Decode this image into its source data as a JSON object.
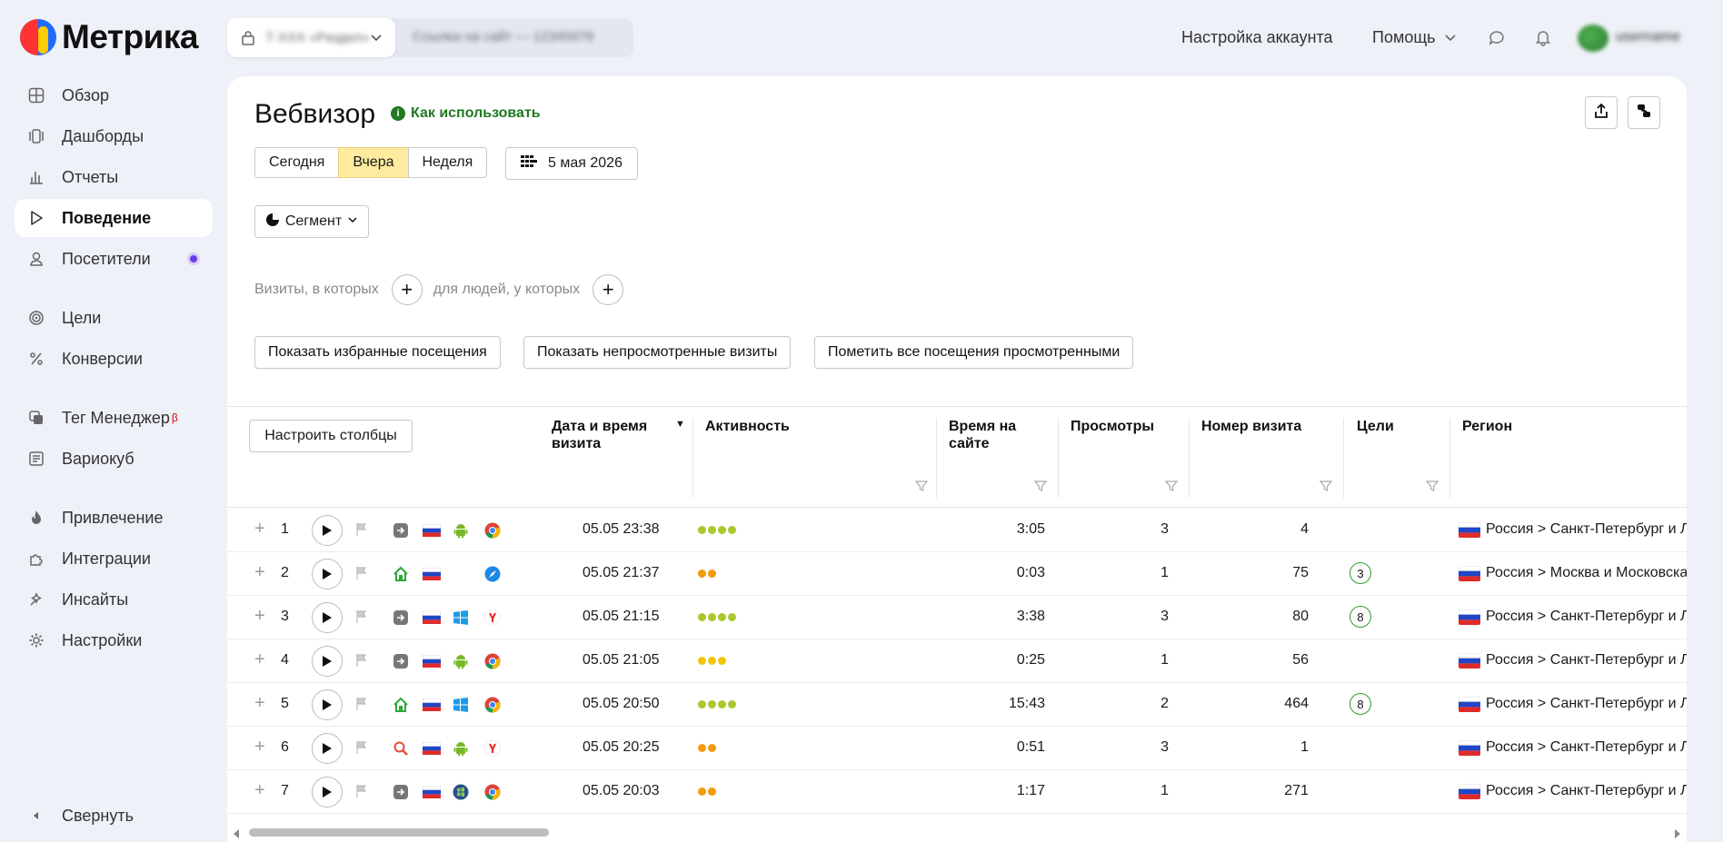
{
  "app": {
    "name": "Метрика"
  },
  "header": {
    "counter_name": "Т-ХХХ «Раздел»",
    "counter_id": "Ссылка на сайт — 12345678",
    "account_settings": "Настройка аккаунта",
    "help": "Помощь",
    "user_name": "username"
  },
  "sidebar": {
    "items": [
      {
        "label": "Обзор",
        "icon": "overview-icon"
      },
      {
        "label": "Дашборды",
        "icon": "dashboards-icon"
      },
      {
        "label": "Отчеты",
        "icon": "reports-icon"
      },
      {
        "label": "Поведение",
        "icon": "behavior-icon",
        "active": true
      },
      {
        "label": "Посетители",
        "icon": "visitors-icon"
      },
      {
        "label": "Цели",
        "icon": "goals-icon"
      },
      {
        "label": "Конверсии",
        "icon": "conversions-icon"
      },
      {
        "label": "Тег Менеджер",
        "icon": "tag-manager-icon",
        "badge": "β"
      },
      {
        "label": "Вариокуб",
        "icon": "variocube-icon"
      },
      {
        "label": "Привлечение",
        "icon": "acquisition-icon"
      },
      {
        "label": "Интеграции",
        "icon": "integrations-icon"
      },
      {
        "label": "Инсайты",
        "icon": "insights-icon"
      },
      {
        "label": "Настройки",
        "icon": "settings-icon"
      }
    ],
    "collapse": "Свернуть"
  },
  "page": {
    "title": "Вебвизор",
    "how_to": "Как использовать",
    "periods": [
      "Сегодня",
      "Вчера",
      "Неделя"
    ],
    "active_period": "Вчера",
    "date": "5 мая 2026",
    "segment": "Сегмент",
    "filter_visits": "Визиты, в которых",
    "filter_people": "для людей, у которых",
    "btn_favorites": "Показать избранные посещения",
    "btn_unwatched": "Показать непросмотренные визиты",
    "btn_mark_all": "Пометить все посещения просмотренными"
  },
  "table": {
    "configure": "Настроить столбцы",
    "columns": {
      "datetime": "Дата и время визита",
      "activity": "Активность",
      "time_on_site": "Время на сайте",
      "views": "Просмотры",
      "visit_number": "Номер визита",
      "goals": "Цели",
      "region": "Регион"
    },
    "sort_indicator": "▼",
    "colors": {
      "green": "#a8c82e",
      "yellow": "#f2c80f",
      "orange": "#f49a0c"
    },
    "rows": [
      {
        "n": "1",
        "source": "direct",
        "os": "android",
        "browser": "chrome",
        "datetime": "05.05 23:38",
        "activity": 4,
        "activity_color": "#a8c82e",
        "time": "3:05",
        "views": "3",
        "visit": "4",
        "goals": "",
        "region": "Россия > Санкт-Петербург и Л"
      },
      {
        "n": "2",
        "source": "internal",
        "os": "",
        "browser": "safari",
        "datetime": "05.05 21:37",
        "activity": 2,
        "activity_color": "#f49a0c",
        "time": "0:03",
        "views": "1",
        "visit": "75",
        "goals": "3",
        "region": "Россия > Москва и Московска"
      },
      {
        "n": "3",
        "source": "direct",
        "os": "windows",
        "browser": "yandex",
        "datetime": "05.05 21:15",
        "activity": 4,
        "activity_color": "#a8c82e",
        "time": "3:38",
        "views": "3",
        "visit": "80",
        "goals": "8",
        "region": "Россия > Санкт-Петербург и Л"
      },
      {
        "n": "4",
        "source": "direct",
        "os": "android",
        "browser": "chrome",
        "datetime": "05.05 21:05",
        "activity": 3,
        "activity_color": "#f2c80f",
        "time": "0:25",
        "views": "1",
        "visit": "56",
        "goals": "",
        "region": "Россия > Санкт-Петербург и Л"
      },
      {
        "n": "5",
        "source": "internal",
        "os": "windows",
        "browser": "chrome",
        "datetime": "05.05 20:50",
        "activity": 4,
        "activity_color": "#a8c82e",
        "time": "15:43",
        "views": "2",
        "visit": "464",
        "goals": "8",
        "region": "Россия > Санкт-Петербург и Л"
      },
      {
        "n": "6",
        "source": "search",
        "os": "android",
        "browser": "yandex",
        "datetime": "05.05 20:25",
        "activity": 2,
        "activity_color": "#f49a0c",
        "time": "0:51",
        "views": "3",
        "visit": "1",
        "goals": "",
        "region": "Россия > Санкт-Петербург и Л"
      },
      {
        "n": "7",
        "source": "direct",
        "os": "windows7",
        "browser": "chrome",
        "datetime": "05.05 20:03",
        "activity": 2,
        "activity_color": "#f49a0c",
        "time": "1:17",
        "views": "1",
        "visit": "271",
        "goals": "",
        "region": "Россия > Санкт-Петербург и Л"
      }
    ]
  }
}
